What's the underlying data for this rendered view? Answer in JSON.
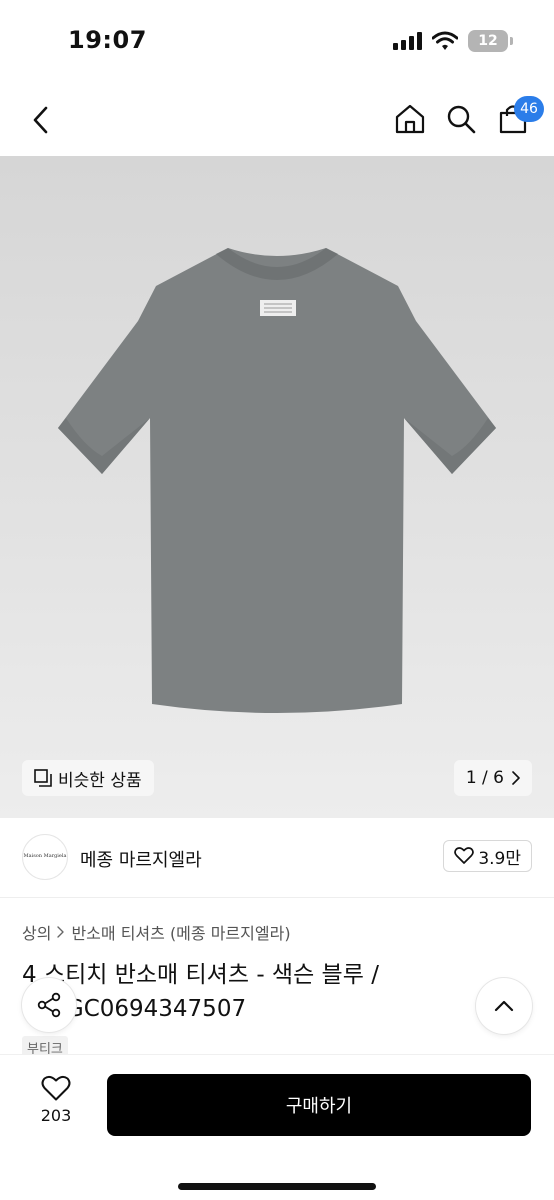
{
  "status_bar": {
    "time": "19:07",
    "battery": "12"
  },
  "nav": {
    "cart_count": "46"
  },
  "gallery": {
    "similar_label": "비슷한 상품",
    "page_indicator": "1 / 6"
  },
  "brand": {
    "logo_text": "Maison Margiela",
    "name": "메종 마르지엘라",
    "likes": "3.9만"
  },
  "breadcrumb": {
    "level1": "상의",
    "level2": "반소매 티셔츠 (메종 마르지엘라)"
  },
  "product": {
    "title": "4 스티치 반소매 티셔츠 - 색슨 블루 / S50GC0694347507",
    "shop_tag": "부티크",
    "tshirt_color": "#7d8182"
  },
  "bottom_bar": {
    "wish_count": "203",
    "buy_label": "구매하기"
  },
  "colors": {
    "cart_badge": "#2b7de9",
    "buy_button": "#000000"
  }
}
